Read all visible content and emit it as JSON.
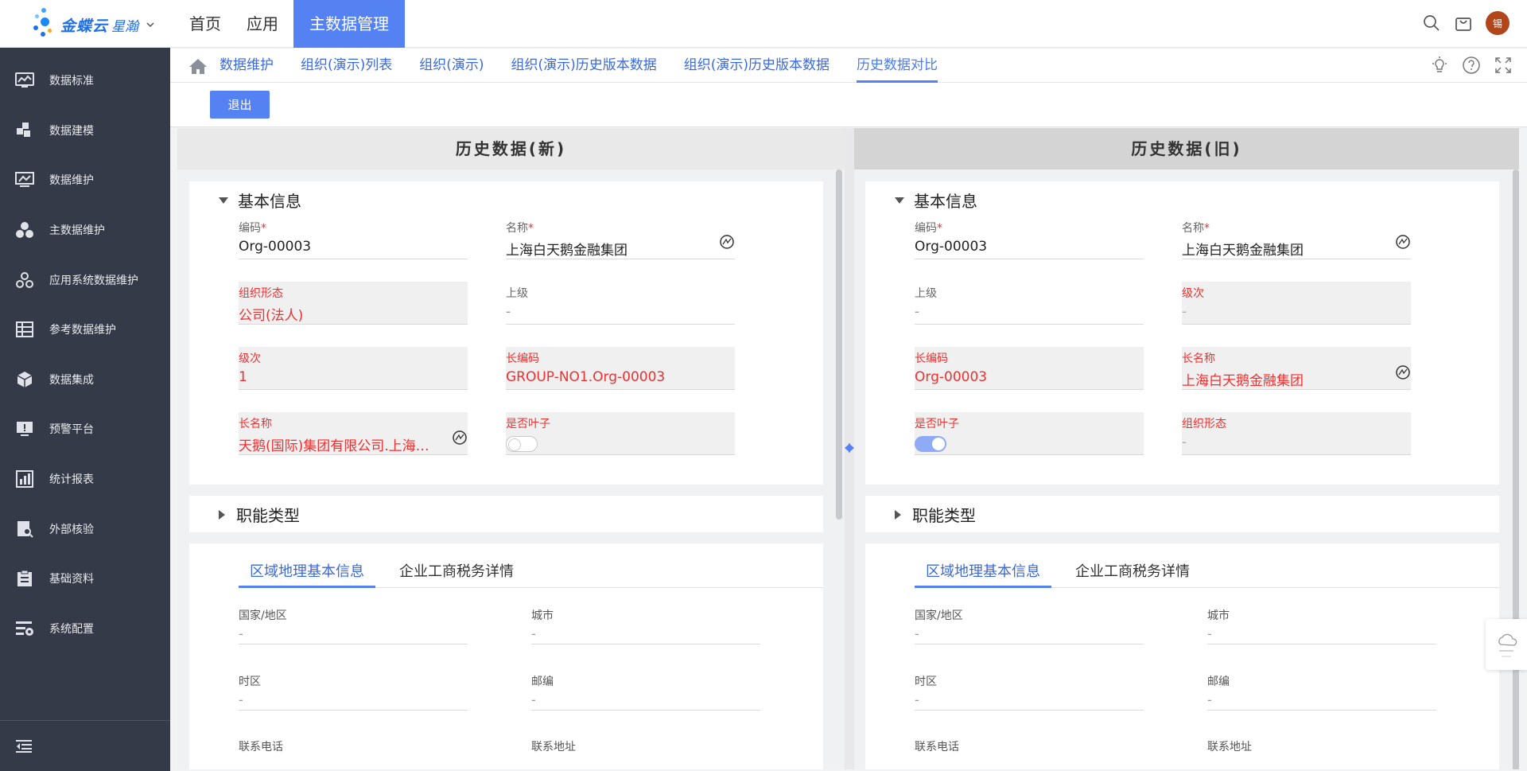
{
  "topbar": {
    "brand": "金蝶云",
    "brand_sub": "星瀚",
    "nav": [
      "首页",
      "应用",
      "主数据管理"
    ],
    "avatar_text": "锡"
  },
  "sidebar": {
    "items": [
      {
        "label": "数据标准",
        "icon": "chart-monitor-icon"
      },
      {
        "label": "数据建模",
        "icon": "blocks-icon"
      },
      {
        "label": "数据维护",
        "icon": "monitor-icon"
      },
      {
        "label": "主数据维护",
        "icon": "cubes-icon"
      },
      {
        "label": "应用系统数据维护",
        "icon": "circles-icon"
      },
      {
        "label": "参考数据维护",
        "icon": "table-icon"
      },
      {
        "label": "数据集成",
        "icon": "box-icon"
      },
      {
        "label": "预警平台",
        "icon": "alert-screen-icon"
      },
      {
        "label": "统计报表",
        "icon": "report-icon"
      },
      {
        "label": "外部核验",
        "icon": "verify-icon"
      },
      {
        "label": "基础资料",
        "icon": "clipboard-icon"
      },
      {
        "label": "系统配置",
        "icon": "settings-list-icon"
      }
    ]
  },
  "tabs": {
    "items": [
      "数据维护",
      "组织(演示)列表",
      "组织(演示)",
      "组织(演示)历史版本数据",
      "组织(演示)历史版本数据",
      "历史数据对比"
    ],
    "active_index": 5
  },
  "toolbar": {
    "exit_label": "退出"
  },
  "left": {
    "title": "历史数据(新)",
    "basic_title": "基本信息",
    "fields": [
      {
        "label": "编码",
        "required": "*",
        "value": "Org-00003"
      },
      {
        "label": "名称",
        "required": "*",
        "value": "上海白天鹅金融集团"
      },
      {
        "label": "组织形态",
        "value": "公司(法人)"
      },
      {
        "label": "上级",
        "value": "-"
      },
      {
        "label": "级次",
        "value": "1"
      },
      {
        "label": "长编码",
        "value": "GROUP-NO1.Org-00003"
      },
      {
        "label": "长名称",
        "value": "天鹅(国际)集团有限公司.上海白天鹅金融集团"
      },
      {
        "label": "是否叶子",
        "value": "off"
      }
    ],
    "func_title": "职能类型",
    "subtabs": [
      "区域地理基本信息",
      "企业工商税务详情"
    ],
    "geo_fields": [
      {
        "label": "国家/地区",
        "value": "-"
      },
      {
        "label": "城市",
        "value": "-"
      },
      {
        "label": "时区",
        "value": "-"
      },
      {
        "label": "邮编",
        "value": "-"
      },
      {
        "label": "联系电话",
        "value": ""
      },
      {
        "label": "联系地址",
        "value": ""
      }
    ]
  },
  "right": {
    "title": "历史数据(旧)",
    "basic_title": "基本信息",
    "fields": [
      {
        "label": "编码",
        "required": "*",
        "value": "Org-00003"
      },
      {
        "label": "名称",
        "required": "*",
        "value": "上海白天鹅金融集团"
      },
      {
        "label": "上级",
        "value": "-"
      },
      {
        "label": "级次",
        "value": "-"
      },
      {
        "label": "长编码",
        "value": "Org-00003"
      },
      {
        "label": "长名称",
        "value": "上海白天鹅金融集团"
      },
      {
        "label": "是否叶子",
        "value": "on"
      },
      {
        "label": "组织形态",
        "value": "-"
      }
    ],
    "func_title": "职能类型",
    "subtabs": [
      "区域地理基本信息",
      "企业工商税务详情"
    ],
    "geo_fields": [
      {
        "label": "国家/地区",
        "value": "-"
      },
      {
        "label": "城市",
        "value": "-"
      },
      {
        "label": "时区",
        "value": "-"
      },
      {
        "label": "邮编",
        "value": "-"
      },
      {
        "label": "联系电话",
        "value": ""
      },
      {
        "label": "联系地址",
        "value": ""
      }
    ]
  },
  "colors": {
    "accent": "#5582f3",
    "sidebar_bg": "#343a48",
    "diff_text": "#f22f2f",
    "avatar_bg": "#b2461b"
  }
}
